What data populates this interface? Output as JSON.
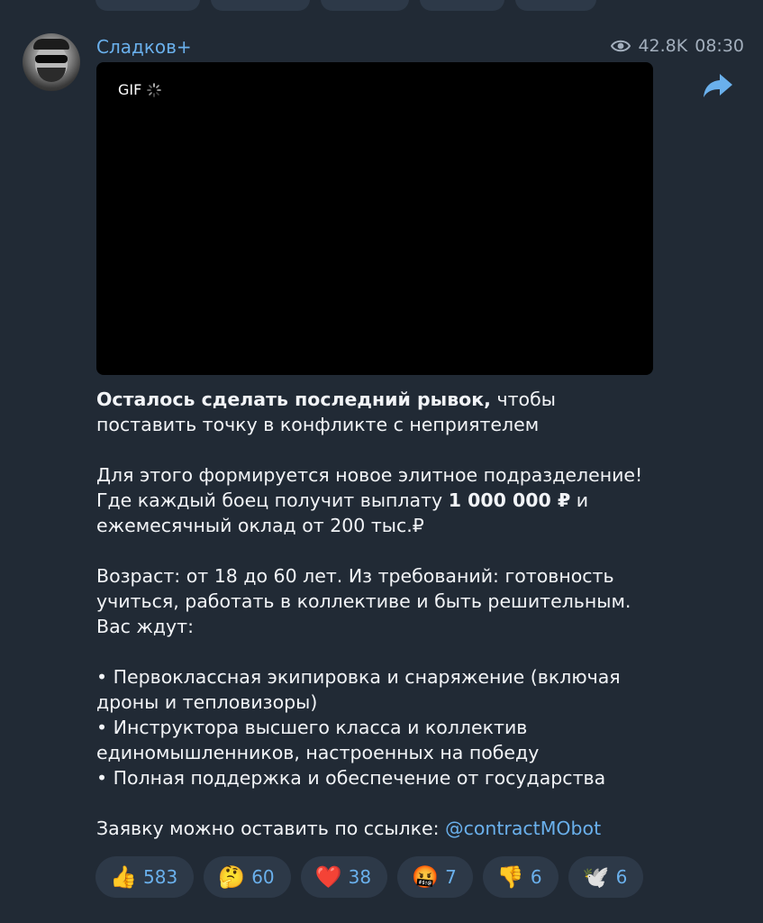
{
  "post": {
    "channel_name": "Сладков+",
    "views": "42.8K",
    "time": "08:30",
    "media_badge": "GIF"
  },
  "message": {
    "p1_bold": "Осталось сделать последний рывок,",
    "p1_rest": " чтобы поставить точку в конфликте с неприятелем",
    "p2_start": "Для этого формируется новое элитное подразделение! Где каждый боец получит выплату ",
    "p2_bold": "1 000 000 ₽",
    "p2_end": " и ежемесячный оклад от 200 тыс.₽",
    "p3": "Возраст: от 18 до 60 лет. Из требований: готовность учиться, работать в коллективе и быть решительным. Вас ждут:",
    "bullets": [
      "• Первоклассная экипировка и снаряжение (включая дроны и тепловизоры)",
      "• Инструктора высшего класса и коллектив единомышленников, настроенных на победу",
      "• Полная поддержка и обеспечение от государства"
    ],
    "p5_text": "Заявку можно оставить по ссылке: ",
    "p5_link": "@contractMObot"
  },
  "reactions": [
    {
      "emoji": "👍",
      "icon": "thumbs-up-icon",
      "count": "583"
    },
    {
      "emoji": "🤔",
      "icon": "thinking-face-icon",
      "count": "60"
    },
    {
      "emoji": "❤️",
      "icon": "red-heart-icon",
      "count": "38"
    },
    {
      "emoji": "🤬",
      "icon": "cursing-face-icon",
      "count": "7"
    },
    {
      "emoji": "👎",
      "icon": "thumbs-down-icon",
      "count": "6"
    },
    {
      "emoji": "🕊️",
      "icon": "dove-icon",
      "count": "6"
    }
  ],
  "colors": {
    "background": "#212a35",
    "accent": "#6ab0ec",
    "pill": "#2d3948",
    "text": "#f2f4f7",
    "meta": "#a3afbd"
  }
}
